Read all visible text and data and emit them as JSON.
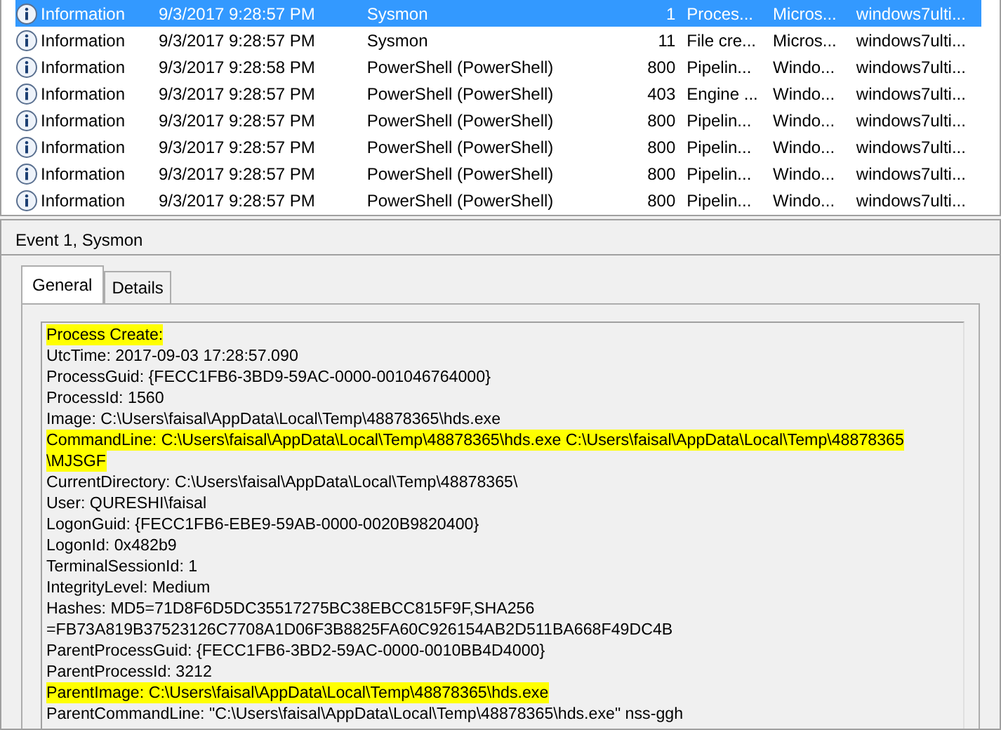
{
  "events": [
    {
      "level": "Information",
      "date": "9/3/2017 9:28:57 PM",
      "source": "Sysmon",
      "event_id": "1",
      "task": "Proces...",
      "keywords": "Micros...",
      "computer": "windows7ulti...",
      "selected": true
    },
    {
      "level": "Information",
      "date": "9/3/2017 9:28:57 PM",
      "source": "Sysmon",
      "event_id": "11",
      "task": "File cre...",
      "keywords": "Micros...",
      "computer": "windows7ulti...",
      "selected": false
    },
    {
      "level": "Information",
      "date": "9/3/2017 9:28:58 PM",
      "source": "PowerShell (PowerShell)",
      "event_id": "800",
      "task": "Pipelin...",
      "keywords": "Windo...",
      "computer": "windows7ulti...",
      "selected": false
    },
    {
      "level": "Information",
      "date": "9/3/2017 9:28:57 PM",
      "source": "PowerShell (PowerShell)",
      "event_id": "403",
      "task": "Engine ...",
      "keywords": "Windo...",
      "computer": "windows7ulti...",
      "selected": false
    },
    {
      "level": "Information",
      "date": "9/3/2017 9:28:57 PM",
      "source": "PowerShell (PowerShell)",
      "event_id": "800",
      "task": "Pipelin...",
      "keywords": "Windo...",
      "computer": "windows7ulti...",
      "selected": false
    },
    {
      "level": "Information",
      "date": "9/3/2017 9:28:57 PM",
      "source": "PowerShell (PowerShell)",
      "event_id": "800",
      "task": "Pipelin...",
      "keywords": "Windo...",
      "computer": "windows7ulti...",
      "selected": false
    },
    {
      "level": "Information",
      "date": "9/3/2017 9:28:57 PM",
      "source": "PowerShell (PowerShell)",
      "event_id": "800",
      "task": "Pipelin...",
      "keywords": "Windo...",
      "computer": "windows7ulti...",
      "selected": false
    },
    {
      "level": "Information",
      "date": "9/3/2017 9:28:57 PM",
      "source": "PowerShell (PowerShell)",
      "event_id": "800",
      "task": "Pipelin...",
      "keywords": "Windo...",
      "computer": "windows7ulti...",
      "selected": false
    }
  ],
  "details": {
    "title": "Event 1, Sysmon",
    "tabs": [
      {
        "label": "General",
        "selected": true
      },
      {
        "label": "Details",
        "selected": false
      }
    ],
    "lines": [
      {
        "text": "Process Create:",
        "highlighted": true
      },
      {
        "text": "UtcTime: 2017-09-03 17:28:57.090",
        "highlighted": false
      },
      {
        "text": "ProcessGuid: {FECC1FB6-3BD9-59AC-0000-001046764000}",
        "highlighted": false
      },
      {
        "text": "ProcessId: 1560",
        "highlighted": false
      },
      {
        "text": "Image: C:\\Users\\faisal\\AppData\\Local\\Temp\\48878365\\hds.exe",
        "highlighted": false
      },
      {
        "text": "CommandLine: C:\\Users\\faisal\\AppData\\Local\\Temp\\48878365\\hds.exe C:\\Users\\faisal\\AppData\\Local\\Temp\\48878365",
        "highlighted": true
      },
      {
        "text": "\\MJSGF",
        "highlighted": true
      },
      {
        "text": "CurrentDirectory: C:\\Users\\faisal\\AppData\\Local\\Temp\\48878365\\",
        "highlighted": false
      },
      {
        "text": "User: QURESHI\\faisal",
        "highlighted": false
      },
      {
        "text": "LogonGuid: {FECC1FB6-EBE9-59AB-0000-0020B9820400}",
        "highlighted": false
      },
      {
        "text": "LogonId: 0x482b9",
        "highlighted": false
      },
      {
        "text": "TerminalSessionId: 1",
        "highlighted": false
      },
      {
        "text": "IntegrityLevel: Medium",
        "highlighted": false
      },
      {
        "text": "Hashes: MD5=71D8F6D5DC35517275BC38EBCC815F9F,SHA256",
        "highlighted": false
      },
      {
        "text": "=FB73A819B37523126C7708A1D06F3B8825FA60C926154AB2D511BA668F49DC4B",
        "highlighted": false
      },
      {
        "text": "ParentProcessGuid: {FECC1FB6-3BD2-59AC-0000-0010BB4D4000}",
        "highlighted": false
      },
      {
        "text": "ParentProcessId: 3212",
        "highlighted": false
      },
      {
        "text": "ParentImage: C:\\Users\\faisal\\AppData\\Local\\Temp\\48878365\\hds.exe",
        "highlighted": true
      },
      {
        "text": "ParentCommandLine: \"C:\\Users\\faisal\\AppData\\Local\\Temp\\48878365\\hds.exe\" nss-ggh",
        "highlighted": false
      }
    ]
  }
}
